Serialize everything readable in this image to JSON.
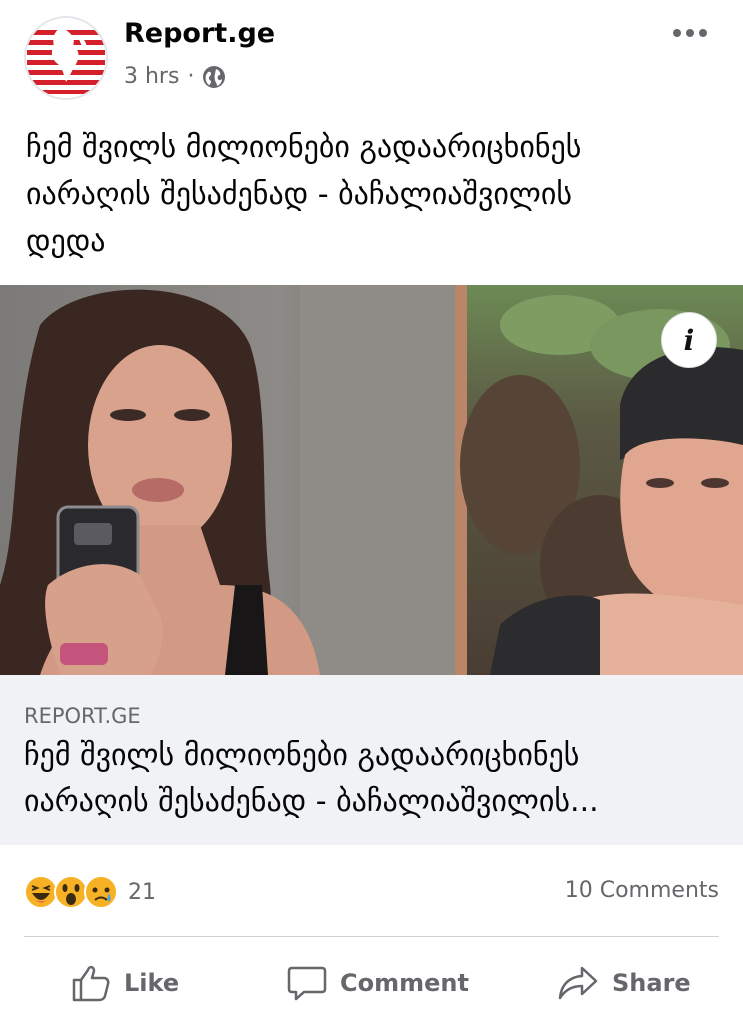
{
  "post": {
    "page_name": "Report.ge",
    "time": "3 hrs",
    "separator": "·",
    "privacy_icon": "globe-icon",
    "text_lines": [
      "ჩემ შვილს მილიონები გადაარიცხინეს",
      "იარაღის შესაძენად - ბაჩალიაშვილის",
      "დედა"
    ]
  },
  "link_preview": {
    "domain": "REPORT.GE",
    "title_lines": [
      "ჩემ შვილს მილიონები გადაარიცხინეს",
      "იარაღის შესაძენად - ბაჩალიაშვილის..."
    ],
    "info_label": "i"
  },
  "engagement": {
    "reaction_icons": [
      "haha-reaction-icon",
      "wow-reaction-icon",
      "sad-reaction-icon"
    ],
    "reaction_count": "21",
    "comments": "10 Comments"
  },
  "actions": {
    "like": "Like",
    "comment": "Comment",
    "share": "Share"
  },
  "colors": {
    "brand_red": "#d4202a",
    "secondary_text": "#65676b",
    "link_bg": "#f0f2f5"
  }
}
